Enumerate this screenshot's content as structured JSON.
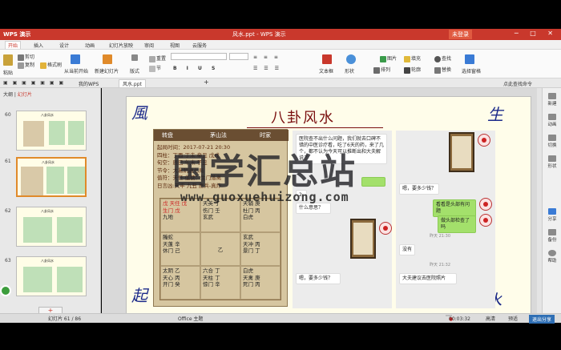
{
  "app": {
    "name": "WPS 演示",
    "document": "风水.ppt - WPS 演示",
    "login": "未登录"
  },
  "menu": [
    "开始",
    "插入",
    "设计",
    "动画",
    "幻灯片放映",
    "审阅",
    "视图",
    "云服务"
  ],
  "ribbon": {
    "paste": "粘贴",
    "cut": "剪切",
    "copy": "复制",
    "format_painter": "格式刷",
    "from_current": "从当前开始",
    "new_slide": "新建幻灯片",
    "layout": "版式",
    "reset": "重置",
    "section": "节",
    "textbox": "文本框",
    "shape": "形状",
    "arrange": "排列",
    "picture": "图片",
    "fill": "填充",
    "outline": "轮廓",
    "find": "查找",
    "replace": "替换",
    "select": "选择窗格"
  },
  "tabs": {
    "my_wps": "我的WPS",
    "doc": "风水.ppt",
    "help": "点此查找命令"
  },
  "left_panel": {
    "tab_outline": "大纲",
    "tab_slides": "幻灯片",
    "slides": [
      {
        "num": "60"
      },
      {
        "num": "61"
      },
      {
        "num": "62"
      },
      {
        "num": "63"
      }
    ]
  },
  "slide": {
    "title": "八卦风水",
    "calli": {
      "tl": "風",
      "tr": "生",
      "bl": "起",
      "br": "水"
    },
    "board": {
      "tab1": "转盘",
      "tab2": "茅山法",
      "tab3": "时家",
      "info": [
        "起局时间：2017-07-21 20:30",
        "四柱：丁酉 丁未 辛丑 戊戌",
        "旬空：辰巳   午未   子丑",
        "节令：大暑阴遁七局",
        "值符：天任  值使：生门落离",
        "日言凶:天牢 九丑 惠兵-真炸"
      ],
      "cells": [
        [
          "戊 天任 戊",
          "生门 戊",
          "九地"
        ],
        [
          "天英 丁",
          "伤门 壬",
          "玄武"
        ],
        [
          "天辅 庚",
          "杜门 丙",
          "白虎"
        ],
        [
          "螣蛇",
          "天蓬 辛",
          "休门 己"
        ],
        [
          "乙"
        ],
        [
          "玄武",
          "天冲 丙",
          "景门 丁"
        ],
        [
          "太阴 乙",
          "天心 丙",
          "开门 癸"
        ],
        [
          "六合 丁",
          "天柱 丁",
          "惊门 辛"
        ],
        [
          "白虎",
          "天禽 庚",
          "死门 丙"
        ]
      ]
    },
    "chat_left": {
      "msg1": "医院查不出什么问题，我们就去口碑不错的中医诊疗看，吃了6天的药，来了几个，都不认为今天可以推断出和大夫解说了",
      "msg2": "什么意思？",
      "msg3": "嗯，要多少钱？",
      "num": "2"
    },
    "chat_right": {
      "msg1": "嗯，要多少钱？",
      "msg2": "看看是头部有问题",
      "msg3": "做头部检查了吗",
      "msg4": "没有",
      "msg5": "大夫建议去医院照片",
      "t1": "昨天 21:30",
      "t2": "昨天 21:32"
    }
  },
  "watermark": {
    "cn": "国学汇总站",
    "url": "www.guoxuehuizong.com"
  },
  "right_tools": [
    "新建",
    "动画",
    "切换",
    "形状",
    "分享",
    "备份",
    "帮助"
  ],
  "status": {
    "page": "幻灯片 61 / 86",
    "theme": "Office 主题",
    "timer": "00:03:32",
    "s1": "高清",
    "s2": "预适",
    "s3": "退出分享"
  }
}
